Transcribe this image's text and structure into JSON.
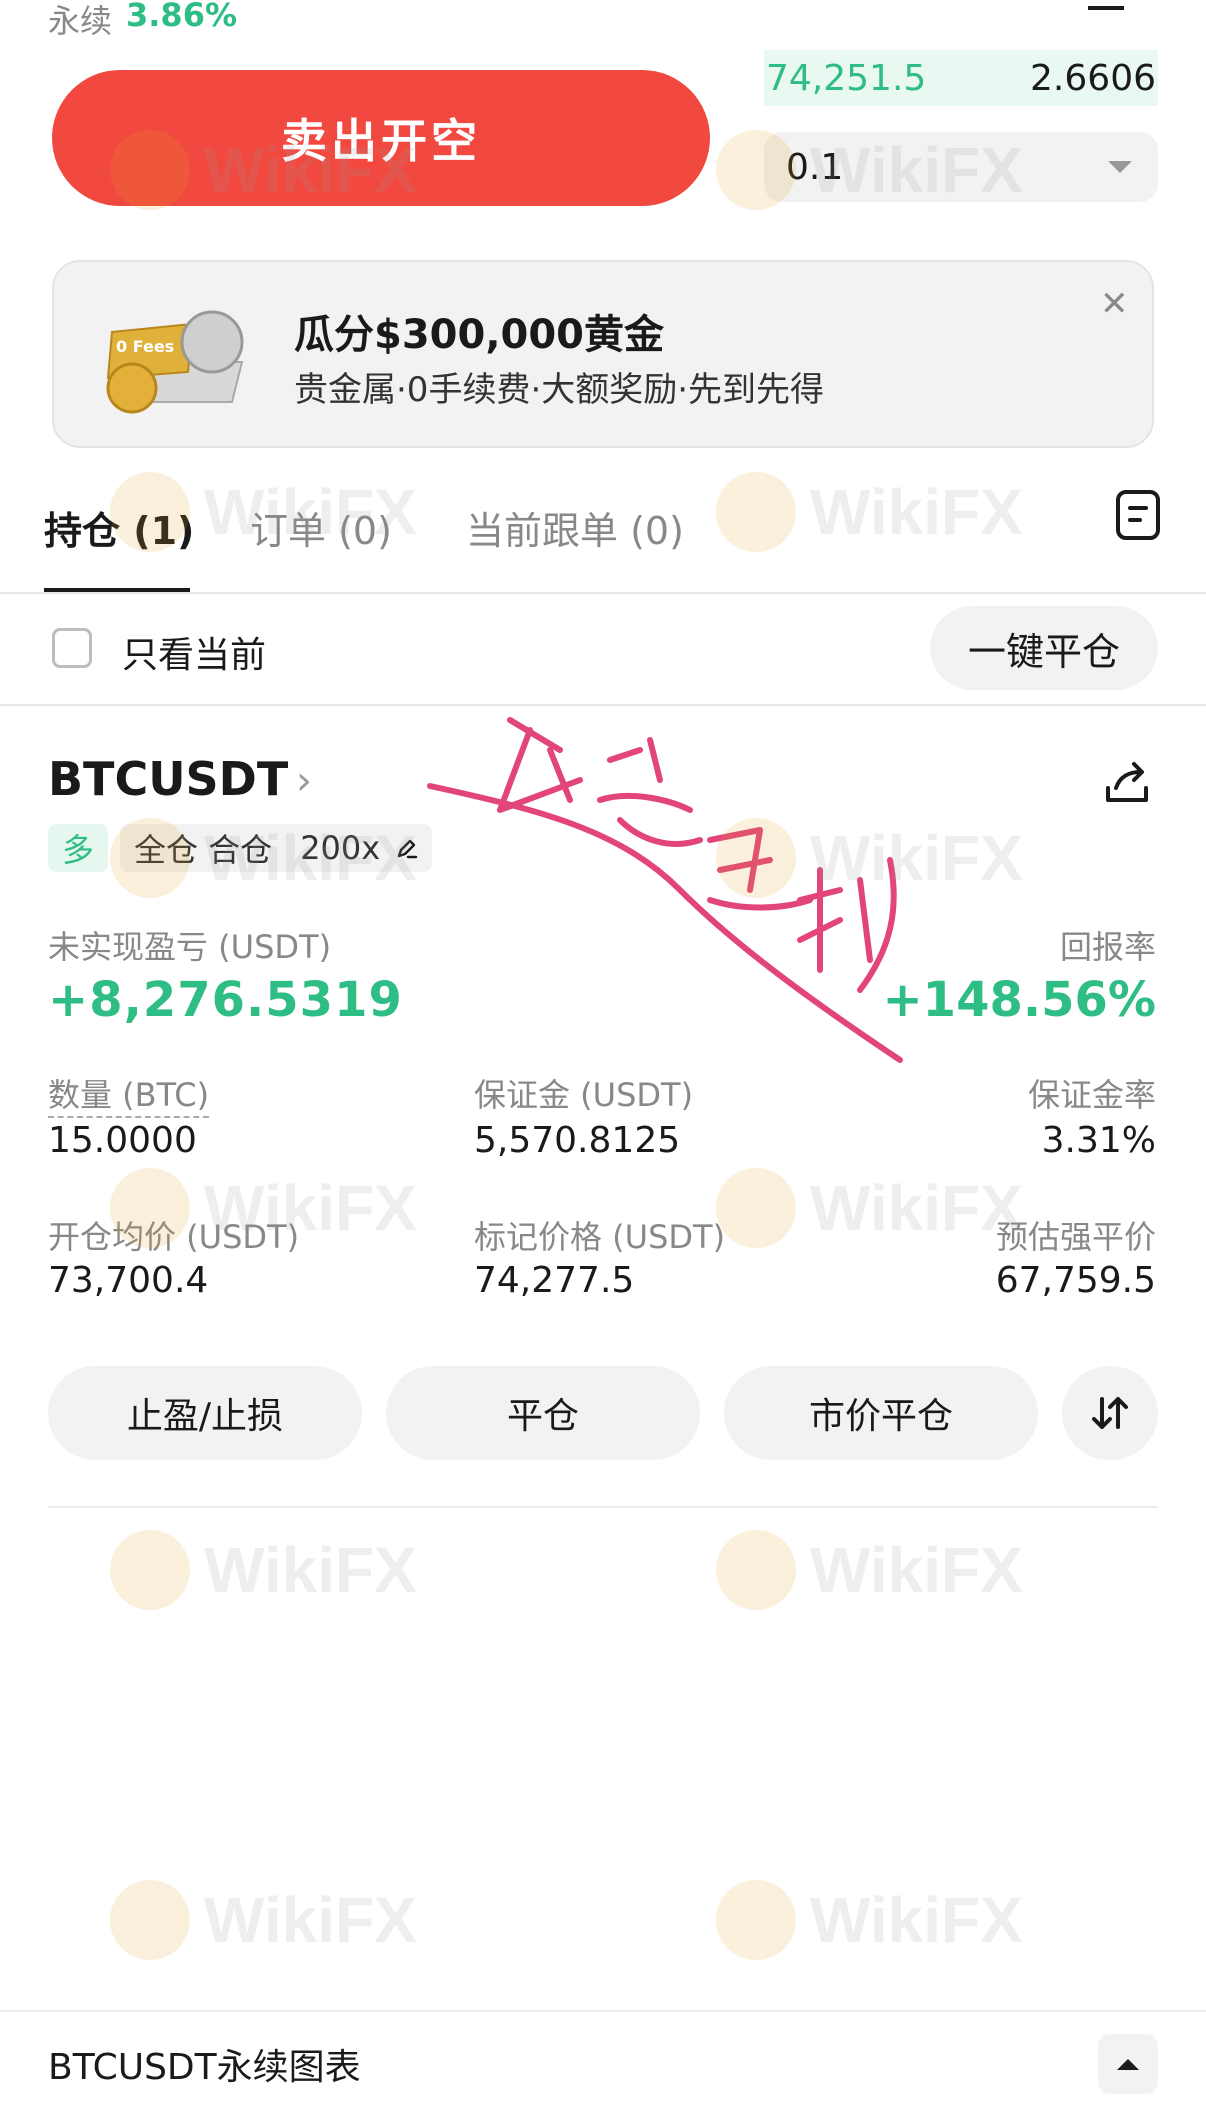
{
  "header": {
    "perp_label": "永续",
    "funding_rate": "3.86%"
  },
  "trade": {
    "sell_button": "卖出开空",
    "orderbook_price": "74,251.5",
    "orderbook_qty": "2.6606",
    "qty_value": "0.1"
  },
  "promo": {
    "title": "瓜分$300,000黄金",
    "subtitle": "贵金属·0手续费·大额奖励·先到先得",
    "art_text": "0 Fees"
  },
  "tabs": [
    {
      "label": "持仓 (1)",
      "active": true
    },
    {
      "label": "订单 (0)",
      "active": false
    },
    {
      "label": "当前跟单 (0)",
      "active": false
    }
  ],
  "filter": {
    "only_current_label": "只看当前",
    "close_all_label": "一键平仓"
  },
  "position": {
    "symbol": "BTCUSDT",
    "side_tag": "多",
    "mode_tags": "全仓 合仓",
    "leverage": "200x",
    "pnl_label": "未实现盈亏 (USDT)",
    "pnl_value": "+8,276.5319",
    "roi_label": "回报率",
    "roi_value": "+148.56%",
    "qty_label": "数量 (BTC)",
    "qty_value": "15.0000",
    "margin_label": "保证金 (USDT)",
    "margin_value": "5,570.8125",
    "margin_ratio_label": "保证金率",
    "margin_ratio_value": "3.31%",
    "entry_label": "开仓均价 (USDT)",
    "entry_value": "73,700.4",
    "mark_label": "标记价格 (USDT)",
    "mark_value": "74,277.5",
    "liq_label": "预估强平价",
    "liq_value": "67,759.5",
    "actions": [
      "止盈/止损",
      "平仓",
      "市价平仓"
    ]
  },
  "watermark": "WikiFX",
  "bottom_bar": {
    "title": "BTCUSDT永续图表"
  },
  "colors": {
    "sell_red": "#f1493f",
    "profit_green": "#2ebd85",
    "handwriting_pink": "#e2457a"
  }
}
